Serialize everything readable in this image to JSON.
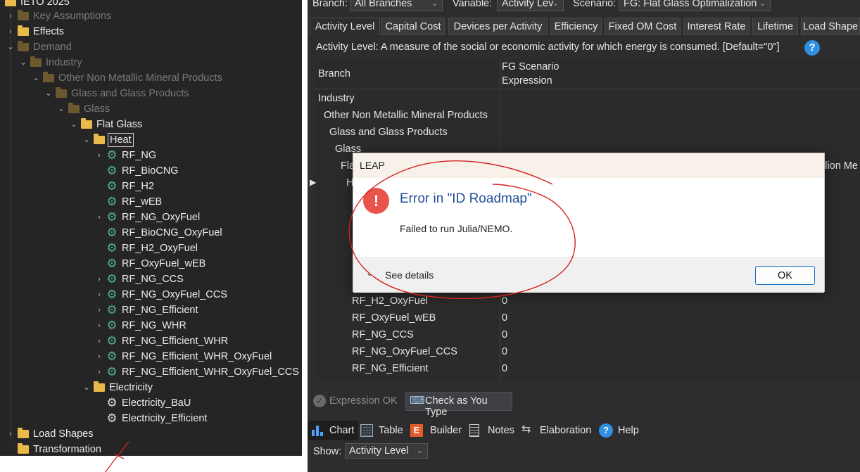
{
  "tree": {
    "items": [
      {
        "label": "IETO 2025",
        "dim": false
      },
      {
        "label": "Key Assumptions",
        "dim": true
      },
      {
        "label": "Effects",
        "dim": false
      },
      {
        "label": "Demand",
        "dim": true
      },
      {
        "label": "Industry",
        "dim": true
      },
      {
        "label": "Other Non Metallic Mineral Products",
        "dim": true
      },
      {
        "label": "Glass and Glass Products",
        "dim": true
      },
      {
        "label": "Glass",
        "dim": true
      },
      {
        "label": "Flat Glass",
        "dim": false
      },
      {
        "label": "Heat",
        "dim": false
      },
      {
        "label": "RF_NG",
        "dim": false
      },
      {
        "label": "RF_BioCNG",
        "dim": false
      },
      {
        "label": "RF_H2",
        "dim": false
      },
      {
        "label": "RF_wEB",
        "dim": false
      },
      {
        "label": "RF_NG_OxyFuel",
        "dim": false
      },
      {
        "label": "RF_BioCNG_OxyFuel",
        "dim": false
      },
      {
        "label": "RF_H2_OxyFuel",
        "dim": false
      },
      {
        "label": "RF_OxyFuel_wEB",
        "dim": false
      },
      {
        "label": "RF_NG_CCS",
        "dim": false
      },
      {
        "label": "RF_NG_OxyFuel_CCS",
        "dim": false
      },
      {
        "label": "RF_NG_Efficient",
        "dim": false
      },
      {
        "label": "RF_NG_WHR",
        "dim": false
      },
      {
        "label": "RF_NG_Efficient_WHR",
        "dim": false
      },
      {
        "label": "RF_NG_Efficient_WHR_OxyFuel",
        "dim": false
      },
      {
        "label": "RF_NG_Efficient_WHR_OxyFuel_CCS",
        "dim": false
      },
      {
        "label": "Electricity",
        "dim": false
      },
      {
        "label": "Electricity_BaU",
        "dim": false
      },
      {
        "label": "Electricity_Efficient",
        "dim": false
      },
      {
        "label": "Load Shapes",
        "dim": false
      },
      {
        "label": "Transformation",
        "dim": false
      }
    ]
  },
  "toolbar": {
    "branch_label": "Branch:",
    "branch_value": "All Branches",
    "variable_label": "Variable:",
    "variable_value": "Activity Lev",
    "scenario_label": "Scenario:",
    "scenario_value": "FG: Flat Glass Optimalization"
  },
  "tabs": [
    "Activity Level",
    "Capital Cost",
    "Devices per Activity",
    "Efficiency",
    "Fixed OM Cost",
    "Interest Rate",
    "Lifetime",
    "Load Shape"
  ],
  "description": "Activity Level: A measure of the social or economic activity for which energy is consumed. [Default=\"0\"]",
  "grid": {
    "col_branch": "Branch",
    "col_expr_1": "FG Scenario",
    "col_expr_2": "Expression",
    "rows": [
      {
        "branch": "Industry",
        "value": ""
      },
      {
        "branch": "Other Non Metallic Mineral Products",
        "value": ""
      },
      {
        "branch": "Glass and Glass Products",
        "value": ""
      },
      {
        "branch": "Glass",
        "value": ""
      },
      {
        "branch": "Fla",
        "value": ""
      },
      {
        "branch": "H",
        "value": ""
      },
      {
        "branch": "RF_H2_OxyFuel",
        "value": "0"
      },
      {
        "branch": "RF_OxyFuel_wEB",
        "value": "0"
      },
      {
        "branch": "RF_NG_CCS",
        "value": "0"
      },
      {
        "branch": "RF_NG_OxyFuel_CCS",
        "value": "0"
      },
      {
        "branch": "RF_NG_Efficient",
        "value": "0"
      }
    ],
    "right_clip": "llion Me"
  },
  "checks": {
    "expression_ok": "Expression OK",
    "check_as_you_type": "Check as You Type"
  },
  "bottom_tabs": [
    "Chart",
    "Table",
    "Builder",
    "Notes",
    "Elaboration",
    "Help"
  ],
  "show": {
    "label": "Show:",
    "value": "Activity Level"
  },
  "dialog": {
    "title": "LEAP",
    "heading": "Error in \"ID Roadmap\"",
    "message": "Failed to run Julia/NEMO.",
    "details": "See details",
    "ok": "OK"
  }
}
